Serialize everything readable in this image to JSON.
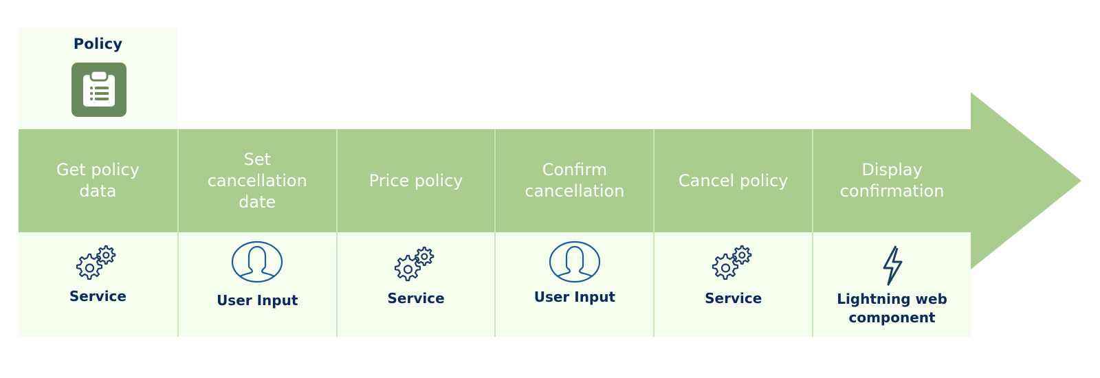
{
  "policy": {
    "title": "Policy",
    "icon": "clipboard-list-icon"
  },
  "colors": {
    "arrow": "#a8cd8e",
    "divider": "#c9e8b6",
    "lower_band": "#f5fdef",
    "text_dark": "#0b2a5b",
    "icon_tile": "#6a8a5e",
    "icon_stroke": "#1b3a66"
  },
  "steps": [
    {
      "title": "Get policy\ndata",
      "type_label": "Service",
      "icon": "gears-icon"
    },
    {
      "title": "Set\ncancellation\ndate",
      "type_label": "User Input",
      "icon": "user-avatar-icon"
    },
    {
      "title": "Price policy",
      "type_label": "Service",
      "icon": "gears-icon"
    },
    {
      "title": "Confirm\ncancellation",
      "type_label": "User Input",
      "icon": "user-avatar-icon"
    },
    {
      "title": "Cancel policy",
      "type_label": "Service",
      "icon": "gears-icon"
    },
    {
      "title": "Display\nconfirmation",
      "type_label": "Lightning web\ncomponent",
      "icon": "lightning-bolt-icon"
    }
  ]
}
